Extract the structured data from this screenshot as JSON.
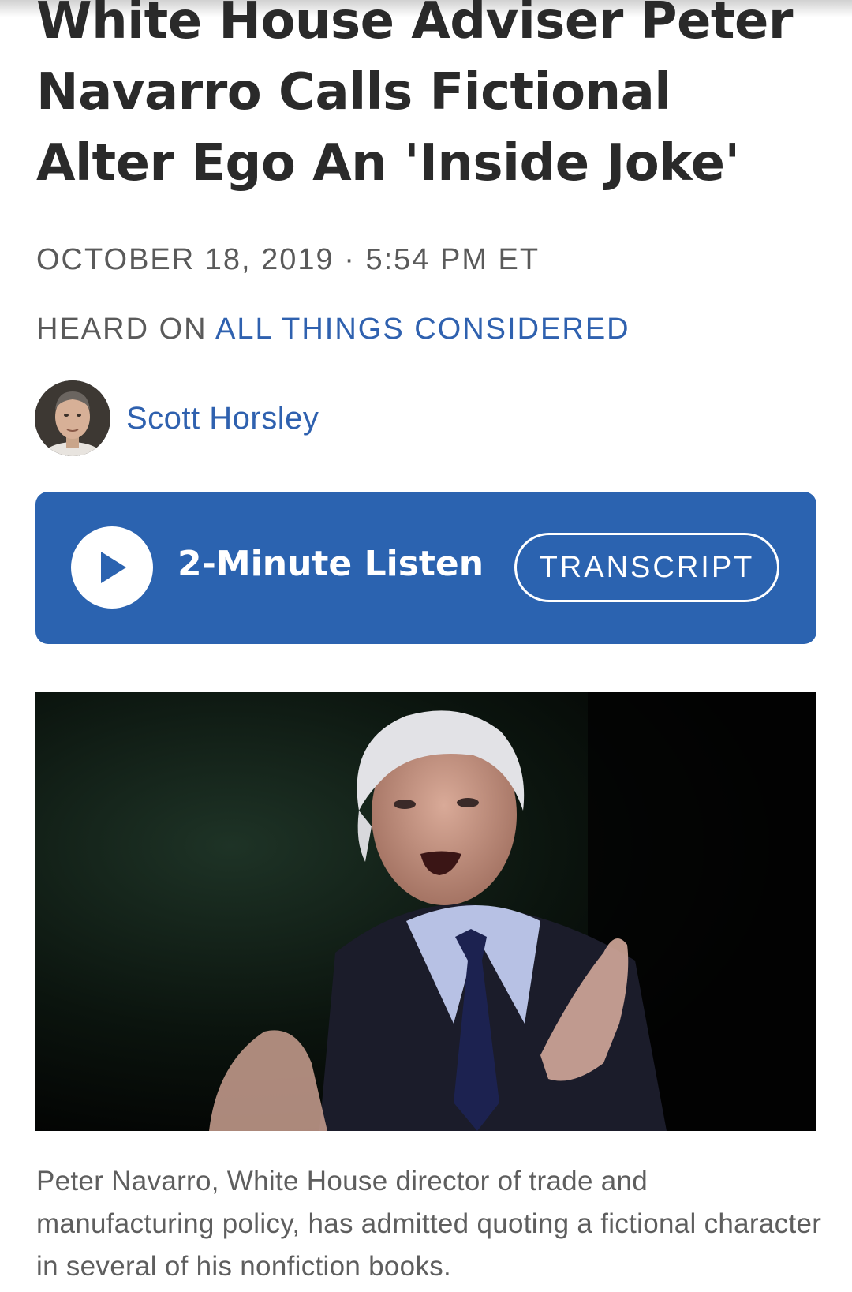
{
  "article": {
    "headline": "White House Adviser Peter Navarro Calls Fictional Alter Ego An 'Inside Joke'",
    "dateline": "OCTOBER 18, 2019 · 5:54 PM ET",
    "heard_on_prefix": "HEARD ON",
    "program": "ALL THINGS CONSIDERED",
    "author": "Scott Horsley"
  },
  "player": {
    "listen_label": "2-Minute Listen",
    "transcript_label": "TRANSCRIPT"
  },
  "photo": {
    "caption": "Peter Navarro, White House director of trade and manufacturing policy, has admitted quoting a fictional character in several of his nonfiction books."
  },
  "colors": {
    "link_blue": "#2f61af",
    "player_blue": "#2b63b0",
    "headline_text": "#2a2a2a",
    "meta_text": "#5a5a5a"
  },
  "icons": {
    "play": "play-icon",
    "author_avatar": "avatar"
  }
}
